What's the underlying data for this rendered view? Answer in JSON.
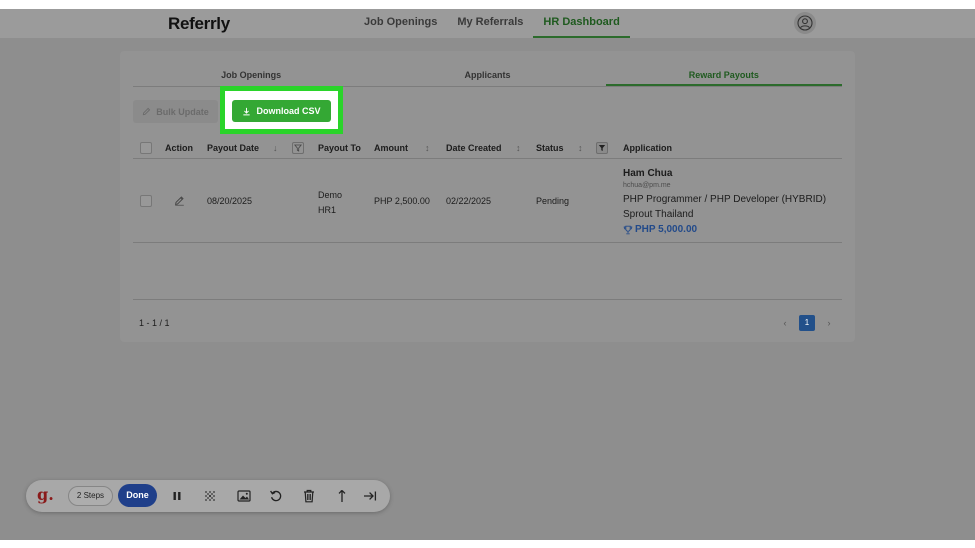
{
  "app": {
    "brand": "Referrly"
  },
  "nav": {
    "items": [
      "Job Openings",
      "My Referrals",
      "HR Dashboard"
    ],
    "active": "HR Dashboard"
  },
  "tabs": {
    "items": [
      "Job Openings",
      "Applicants",
      "Reward Payouts"
    ],
    "active": "Reward Payouts"
  },
  "toolbar_actions": {
    "bulk_update": "Bulk Update",
    "download_csv": "Download CSV"
  },
  "table": {
    "columns": {
      "action": "Action",
      "payout_date": "Payout Date",
      "payout_to": "Payout To",
      "amount": "Amount",
      "date_created": "Date Created",
      "status": "Status",
      "application": "Application"
    },
    "sort_indicators": {
      "payout_date": "↓",
      "amount": "↕",
      "date_created": "↕",
      "status": "↕"
    },
    "rows": [
      {
        "payout_date": "08/20/2025",
        "payout_to_line1": "Demo",
        "payout_to_line2": "HR1",
        "amount": "PHP 2,500.00",
        "date_created": "02/22/2025",
        "status": "Pending",
        "application": {
          "name": "Ham Chua",
          "email": "hchua@pm.me",
          "position": "PHP Programmer / PHP Developer (HYBRID)",
          "company": "Sprout Thailand",
          "reward": "PHP 5,000.00"
        }
      }
    ]
  },
  "pagination": {
    "range": "1 - 1 / 1",
    "current_page": "1",
    "prev": "‹",
    "next": "›"
  },
  "recorder": {
    "logo": "g.",
    "steps": "2 Steps",
    "done": "Done"
  },
  "colors": {
    "accent_green": "#34a834",
    "highlight_green": "#2ad42a",
    "link_blue": "#224a8a",
    "page_active": "#22508a",
    "done_blue": "#1f3f8a"
  }
}
